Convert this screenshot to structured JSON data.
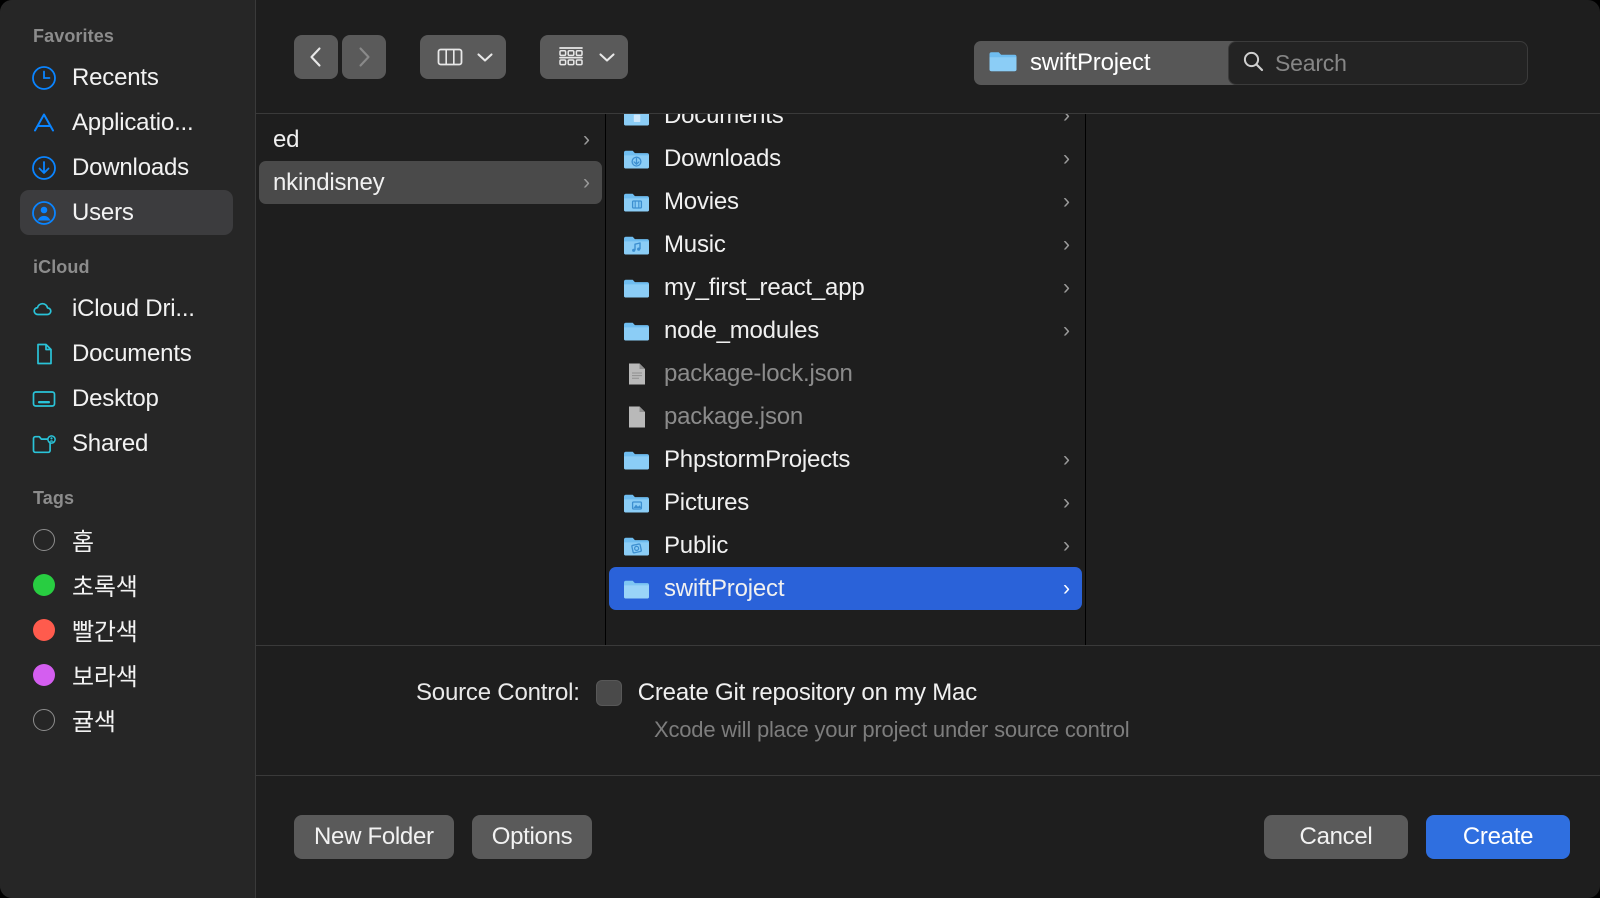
{
  "sidebar": {
    "groups": [
      {
        "title": "Favorites",
        "items": [
          {
            "label": "Recents",
            "icon": "clock-icon",
            "selected": false
          },
          {
            "label": "Applicatio...",
            "icon": "applications-icon",
            "selected": false
          },
          {
            "label": "Downloads",
            "icon": "downloads-icon",
            "selected": false
          },
          {
            "label": "Users",
            "icon": "user-icon",
            "selected": true
          }
        ]
      },
      {
        "title": "iCloud",
        "items": [
          {
            "label": "iCloud Dri...",
            "icon": "cloud-icon",
            "selected": false
          },
          {
            "label": "Documents",
            "icon": "document-icon",
            "selected": false
          },
          {
            "label": "Desktop",
            "icon": "desktop-icon",
            "selected": false
          },
          {
            "label": "Shared",
            "icon": "shared-folder-icon",
            "selected": false
          }
        ]
      },
      {
        "title": "Tags",
        "items": [
          {
            "label": "홈",
            "icon": "tag-dot-icon",
            "color": "none",
            "selected": false
          },
          {
            "label": "초록색",
            "icon": "tag-dot-icon",
            "color": "#28cd41",
            "selected": false
          },
          {
            "label": "빨간색",
            "icon": "tag-dot-icon",
            "color": "#ff5b4d",
            "selected": false
          },
          {
            "label": "보라색",
            "icon": "tag-dot-icon",
            "color": "#d45ef0",
            "selected": false
          },
          {
            "label": "귤색",
            "icon": "tag-dot-icon",
            "color": "none",
            "selected": false
          }
        ]
      }
    ]
  },
  "toolbar": {
    "back_label": "‹",
    "forward_label": "›",
    "view_mode": "column-view",
    "group_mode": "gallery-view",
    "path_label": "swiftProject",
    "search_placeholder": "Search",
    "search_value": ""
  },
  "browser": {
    "column1": [
      {
        "label": "ed",
        "type": "folder-truncated",
        "disclosure": true,
        "selected": false
      },
      {
        "label": "nkindisney",
        "type": "folder-truncated",
        "disclosure": true,
        "selected": true
      }
    ],
    "column2": [
      {
        "label": "Documents",
        "type": "folder-documents",
        "disclosure": true,
        "selected": false,
        "partial": true
      },
      {
        "label": "Downloads",
        "type": "folder-downloads",
        "disclosure": true,
        "selected": false
      },
      {
        "label": "Movies",
        "type": "folder-movies",
        "disclosure": true,
        "selected": false
      },
      {
        "label": "Music",
        "type": "folder-music",
        "disclosure": true,
        "selected": false
      },
      {
        "label": "my_first_react_app",
        "type": "folder-plain",
        "disclosure": true,
        "selected": false
      },
      {
        "label": "node_modules",
        "type": "folder-plain",
        "disclosure": true,
        "selected": false
      },
      {
        "label": "package-lock.json",
        "type": "file",
        "disclosure": false,
        "selected": false,
        "dimmed": true
      },
      {
        "label": "package.json",
        "type": "file",
        "disclosure": false,
        "selected": false,
        "dimmed": true
      },
      {
        "label": "PhpstormProjects",
        "type": "folder-plain",
        "disclosure": true,
        "selected": false
      },
      {
        "label": "Pictures",
        "type": "folder-pictures",
        "disclosure": true,
        "selected": false
      },
      {
        "label": "Public",
        "type": "folder-public",
        "disclosure": true,
        "selected": false
      },
      {
        "label": "swiftProject",
        "type": "folder-plain",
        "disclosure": true,
        "selected": true
      }
    ],
    "column3": []
  },
  "accessory": {
    "source_control_label": "Source Control:",
    "checkbox_label": "Create Git repository on my Mac",
    "checkbox_checked": false,
    "hint": "Xcode will place your project under source control"
  },
  "footer": {
    "new_folder_label": "New Folder",
    "options_label": "Options",
    "cancel_label": "Cancel",
    "create_label": "Create"
  },
  "colors": {
    "accent": "#2f6fe0",
    "selection_blue": "#2a62d9",
    "sidebar_bg": "#262626",
    "window_bg": "#1e1e1e"
  }
}
